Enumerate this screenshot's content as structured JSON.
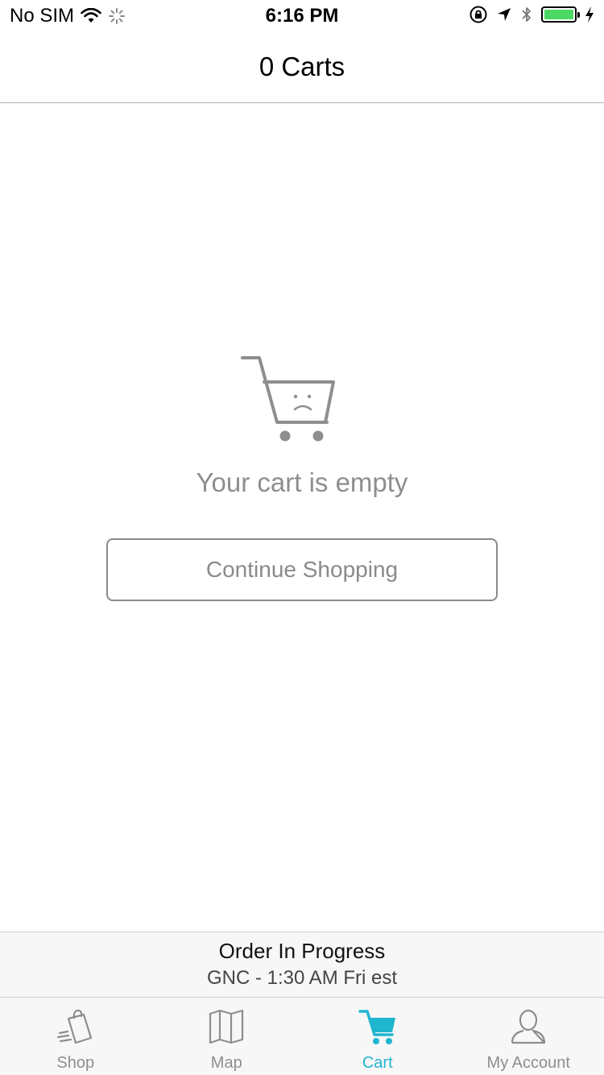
{
  "status_bar": {
    "carrier": "No SIM",
    "time": "6:16 PM",
    "battery_color": "#4cd964"
  },
  "nav": {
    "title": "0 Carts"
  },
  "empty_state": {
    "icon": "sad-cart-icon",
    "message": "Your cart is empty",
    "button_label": "Continue Shopping"
  },
  "order_banner": {
    "title": "Order In Progress",
    "subtitle": "GNC - 1:30 AM Fri est"
  },
  "tab_bar": {
    "active_color": "#1fb6d0",
    "inactive_color": "#8e8e8e",
    "tabs": [
      {
        "label": "Shop",
        "icon": "shopping-bag-icon",
        "active": false
      },
      {
        "label": "Map",
        "icon": "map-icon",
        "active": false
      },
      {
        "label": "Cart",
        "icon": "cart-icon",
        "active": true
      },
      {
        "label": "My Account",
        "icon": "account-icon",
        "active": false
      }
    ]
  }
}
